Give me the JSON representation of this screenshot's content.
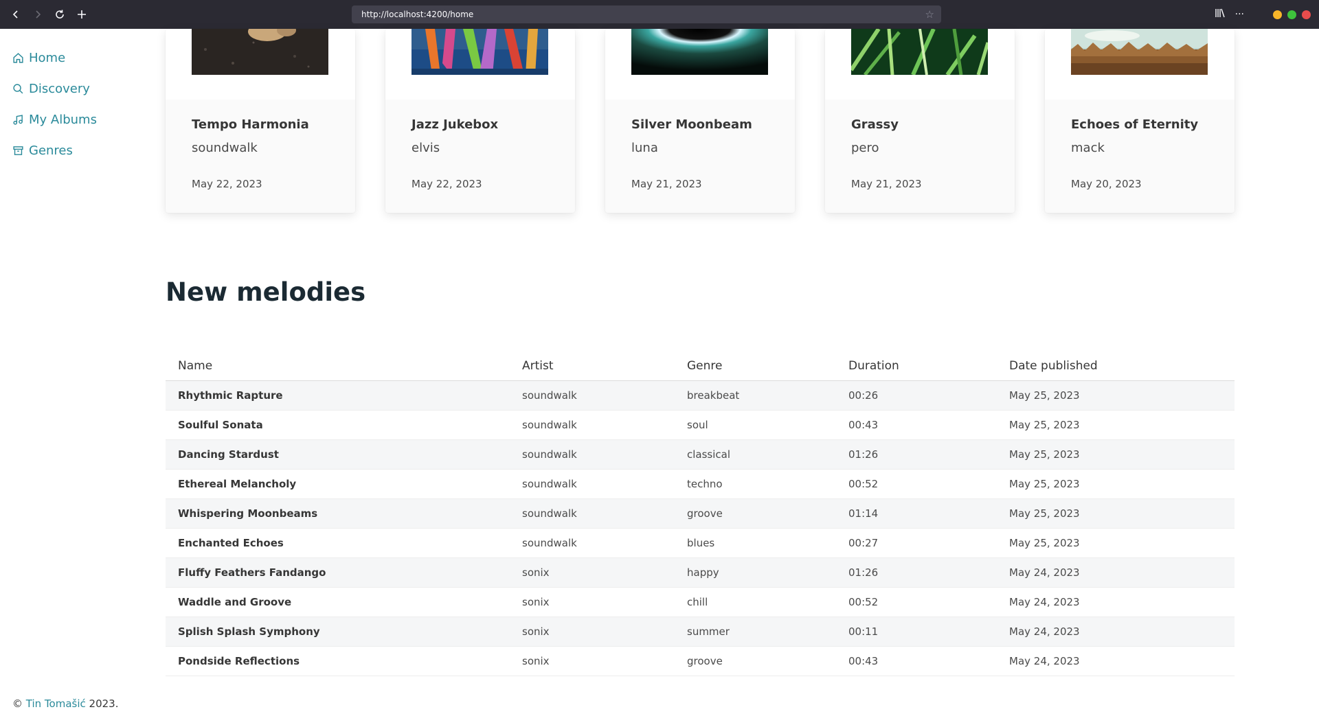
{
  "browser": {
    "url": "http://localhost:4200/home",
    "window_dot_colors": [
      "#f8b629",
      "#3ec33c",
      "#e94c4c"
    ]
  },
  "sidebar": {
    "items": [
      {
        "label": "Home",
        "icon": "home-icon"
      },
      {
        "label": "Discovery",
        "icon": "search-icon"
      },
      {
        "label": "My Albums",
        "icon": "music-note-icon"
      },
      {
        "label": "Genres",
        "icon": "archive-icon"
      }
    ]
  },
  "albums": [
    {
      "title": "Tempo Harmonia",
      "artist": "soundwalk",
      "date": "May 22, 2023",
      "cover": "dark soil with potatoes"
    },
    {
      "title": "Jazz Jukebox",
      "artist": "elvis",
      "date": "May 22, 2023",
      "cover": "colorful dancing figures"
    },
    {
      "title": "Silver Moonbeam",
      "artist": "luna",
      "date": "May 21, 2023",
      "cover": "glowing vinyl ring"
    },
    {
      "title": "Grassy",
      "artist": "pero",
      "date": "May 21, 2023",
      "cover": "green grass blades"
    },
    {
      "title": "Echoes of Eternity",
      "artist": "mack",
      "date": "May 20, 2023",
      "cover": "wheat field under sky"
    }
  ],
  "section": {
    "title": "New melodies"
  },
  "table": {
    "headers": [
      "Name",
      "Artist",
      "Genre",
      "Duration",
      "Date published"
    ],
    "rows": [
      [
        "Rhythmic Rapture",
        "soundwalk",
        "breakbeat",
        "00:26",
        "May 25, 2023"
      ],
      [
        "Soulful Sonata",
        "soundwalk",
        "soul",
        "00:43",
        "May 25, 2023"
      ],
      [
        "Dancing Stardust",
        "soundwalk",
        "classical",
        "01:26",
        "May 25, 2023"
      ],
      [
        "Ethereal Melancholy",
        "soundwalk",
        "techno",
        "00:52",
        "May 25, 2023"
      ],
      [
        "Whispering Moonbeams",
        "soundwalk",
        "groove",
        "01:14",
        "May 25, 2023"
      ],
      [
        "Enchanted Echoes",
        "soundwalk",
        "blues",
        "00:27",
        "May 25, 2023"
      ],
      [
        "Fluffy Feathers Fandango",
        "sonix",
        "happy",
        "01:26",
        "May 24, 2023"
      ],
      [
        "Waddle and Groove",
        "sonix",
        "chill",
        "00:52",
        "May 24, 2023"
      ],
      [
        "Splish Splash Symphony",
        "sonix",
        "summer",
        "00:11",
        "May 24, 2023"
      ],
      [
        "Pondside Reflections",
        "sonix",
        "groove",
        "00:43",
        "May 24, 2023"
      ]
    ]
  },
  "footer": {
    "copyright": "©",
    "author": "Tin Tomašić",
    "year": "2023."
  },
  "colors": {
    "accent": "#2a8a9a",
    "heading": "#1b2a33"
  }
}
